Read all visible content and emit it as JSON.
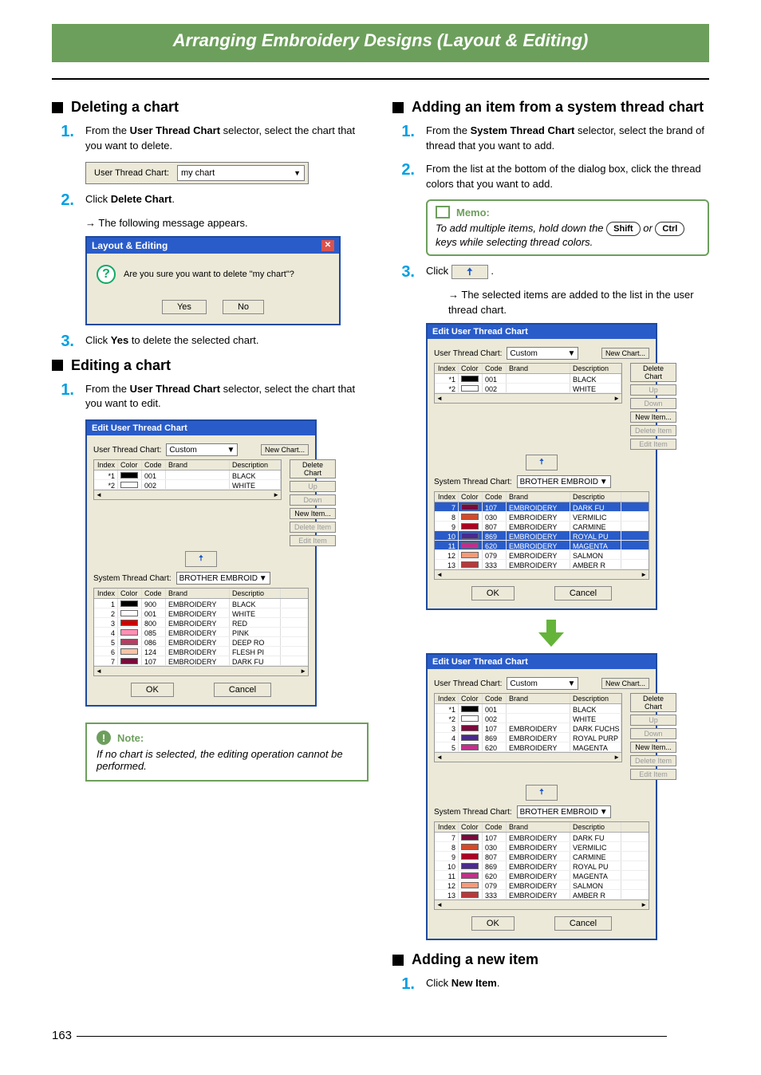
{
  "chapterTitle": "Arranging Embroidery Designs (Layout & Editing)",
  "pageNumber": "163",
  "left": {
    "deleteHeading": "Deleting a chart",
    "editHeading": "Editing a chart",
    "step1a": "From the ",
    "step1bold": "User Thread Chart",
    "step1b": " selector, select the chart that you want to delete.",
    "dropdownLabel": "User Thread Chart:",
    "dropdownValue": "my chart",
    "step2a": "Click ",
    "step2bold": "Delete Chart",
    "step2b": ".",
    "step2result": "The following message appears.",
    "msgTitle": "Layout & Editing",
    "msgText": "Are you sure you want to delete \"my chart\"?",
    "msgYes": "Yes",
    "msgNo": "No",
    "step3a": "Click ",
    "step3bold": "Yes",
    "step3b": " to delete the selected chart.",
    "editStep1a": "From the ",
    "editStep1bold": "User Thread Chart",
    "editStep1b": " selector, select the chart that you want to edit.",
    "noteTitle": "Note:",
    "noteBody": "If no chart is selected, the editing operation cannot be performed."
  },
  "right": {
    "addSysHeading": "Adding an item from a system thread chart",
    "addNewHeading": "Adding a new item",
    "step1a": "From the ",
    "step1bold": "System Thread Chart",
    "step1b": " selector, select the brand of thread that you want to add.",
    "step2": "From the list at the bottom of the dialog box, click the thread colors that you want to add.",
    "memoTitle": "Memo:",
    "memoBodyA": "To add multiple items, hold down the ",
    "memoBodyB": " or ",
    "memoBodyC": " keys while selecting thread colors.",
    "keyShift": "Shift",
    "keyCtrl": "Ctrl",
    "step3pre": "Click ",
    "step3post": " .",
    "step3result": "The selected items are added to the list in the user thread chart.",
    "newItemStepA": "Click ",
    "newItemStepBold": "New Item",
    "newItemStepB": "."
  },
  "dialog": {
    "title": "Edit User Thread Chart",
    "userLabel": "User Thread Chart:",
    "userValue": "Custom",
    "sysLabel": "System Thread Chart:",
    "sysValue": "BROTHER EMBROID",
    "btnNewChart": "New Chart...",
    "btnDeleteChart": "Delete Chart",
    "btnUp": "Up",
    "btnDown": "Down",
    "btnNewItem": "New Item...",
    "btnDeleteItem": "Delete Item",
    "btnEditItem": "Edit Item",
    "btnOK": "OK",
    "btnCancel": "Cancel",
    "headers": {
      "index": "Index",
      "color": "Color",
      "code": "Code",
      "brand": "Brand",
      "desc": "Description",
      "descS": "Descriptio"
    },
    "userRowsA": [
      {
        "idx": "*1",
        "color": "#000000",
        "code": "001",
        "brand": "",
        "desc": "BLACK"
      },
      {
        "idx": "*2",
        "color": "#ffffff",
        "code": "002",
        "brand": "",
        "desc": "WHITE"
      }
    ],
    "sysRowsA": [
      {
        "idx": "1",
        "color": "#000000",
        "code": "900",
        "brand": "EMBROIDERY",
        "desc": "BLACK"
      },
      {
        "idx": "2",
        "color": "#ffffff",
        "code": "001",
        "brand": "EMBROIDERY",
        "desc": "WHITE"
      },
      {
        "idx": "3",
        "color": "#cc0000",
        "code": "800",
        "brand": "EMBROIDERY",
        "desc": "RED"
      },
      {
        "idx": "4",
        "color": "#ff8fb5",
        "code": "085",
        "brand": "EMBROIDERY",
        "desc": "PINK"
      },
      {
        "idx": "5",
        "color": "#b33f62",
        "code": "086",
        "brand": "EMBROIDERY",
        "desc": "DEEP RO"
      },
      {
        "idx": "6",
        "color": "#f6c3a5",
        "code": "124",
        "brand": "EMBROIDERY",
        "desc": "FLESH PI"
      },
      {
        "idx": "7",
        "color": "#7a0a3c",
        "code": "107",
        "brand": "EMBROIDERY",
        "desc": "DARK FU"
      }
    ],
    "sysRowsB": [
      {
        "idx": "7",
        "color": "#7a0a3c",
        "code": "107",
        "brand": "EMBROIDERY",
        "desc": "DARK FU",
        "sel": true
      },
      {
        "idx": "8",
        "color": "#d34a2a",
        "code": "030",
        "brand": "EMBROIDERY",
        "desc": "VERMILIC"
      },
      {
        "idx": "9",
        "color": "#b00020",
        "code": "807",
        "brand": "EMBROIDERY",
        "desc": "CARMINE"
      },
      {
        "idx": "10",
        "color": "#4a2a8c",
        "code": "869",
        "brand": "EMBROIDERY",
        "desc": "ROYAL PU",
        "sel": true
      },
      {
        "idx": "11",
        "color": "#c32f8a",
        "code": "620",
        "brand": "EMBROIDERY",
        "desc": "MAGENTA",
        "sel": true
      },
      {
        "idx": "12",
        "color": "#f59a7a",
        "code": "079",
        "brand": "EMBROIDERY",
        "desc": "SALMON"
      },
      {
        "idx": "13",
        "color": "#b8393a",
        "code": "333",
        "brand": "EMBROIDERY",
        "desc": "AMBER R"
      }
    ],
    "userRowsC": [
      {
        "idx": "*1",
        "color": "#000000",
        "code": "001",
        "brand": "",
        "desc": "BLACK"
      },
      {
        "idx": "*2",
        "color": "#ffffff",
        "code": "002",
        "brand": "",
        "desc": "WHITE"
      },
      {
        "idx": "3",
        "color": "#7a0a3c",
        "code": "107",
        "brand": "EMBROIDERY",
        "desc": "DARK FUCHS"
      },
      {
        "idx": "4",
        "color": "#4a2a8c",
        "code": "869",
        "brand": "EMBROIDERY",
        "desc": "ROYAL PURP"
      },
      {
        "idx": "5",
        "color": "#c32f8a",
        "code": "620",
        "brand": "EMBROIDERY",
        "desc": "MAGENTA"
      }
    ],
    "sysRowsC": [
      {
        "idx": "7",
        "color": "#7a0a3c",
        "code": "107",
        "brand": "EMBROIDERY",
        "desc": "DARK FU"
      },
      {
        "idx": "8",
        "color": "#d34a2a",
        "code": "030",
        "brand": "EMBROIDERY",
        "desc": "VERMILIC"
      },
      {
        "idx": "9",
        "color": "#b00020",
        "code": "807",
        "brand": "EMBROIDERY",
        "desc": "CARMINE"
      },
      {
        "idx": "10",
        "color": "#4a2a8c",
        "code": "869",
        "brand": "EMBROIDERY",
        "desc": "ROYAL PU"
      },
      {
        "idx": "11",
        "color": "#c32f8a",
        "code": "620",
        "brand": "EMBROIDERY",
        "desc": "MAGENTA"
      },
      {
        "idx": "12",
        "color": "#f59a7a",
        "code": "079",
        "brand": "EMBROIDERY",
        "desc": "SALMON"
      },
      {
        "idx": "13",
        "color": "#b8393a",
        "code": "333",
        "brand": "EMBROIDERY",
        "desc": "AMBER R"
      }
    ]
  }
}
